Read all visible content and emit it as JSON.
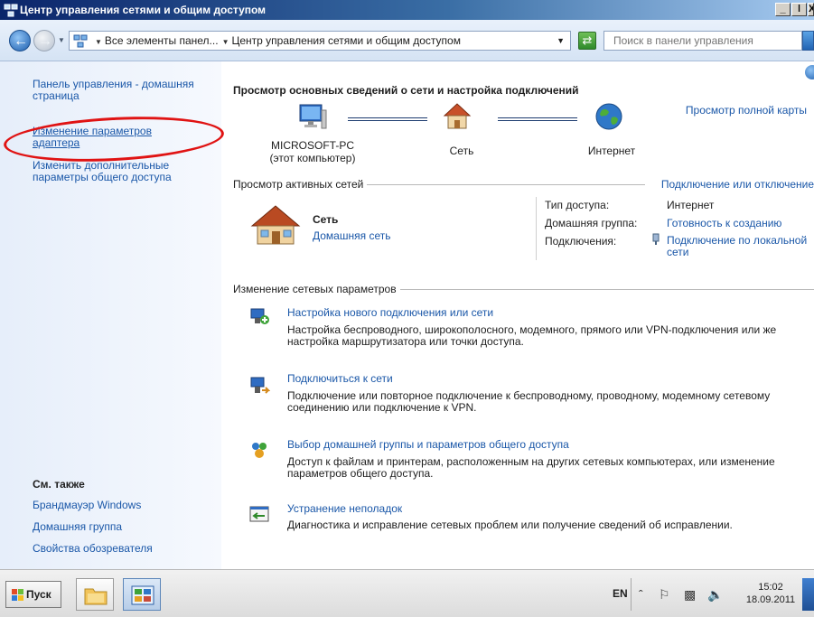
{
  "window": {
    "title": "Центр управления сетями и общим доступом",
    "min": "_",
    "max": "ǀ",
    "close": "X"
  },
  "address": {
    "crumbs": [
      "Все элементы панел...",
      "Центр управления сетями и общим доступом"
    ],
    "search_placeholder": "Поиск в панели управления"
  },
  "sidebar": {
    "home": "Панель управления - домашняя страница",
    "adapter": "Изменение параметров адаптера",
    "sharing": "Изменить дополнительные параметры общего доступа",
    "see_also": "См. также",
    "firewall": "Брандмауэр Windows",
    "homegroup": "Домашняя группа",
    "browser": "Свойства обозревателя"
  },
  "main": {
    "title": "Просмотр основных сведений о сети и настройка подключений",
    "full_map": "Просмотр полной карты",
    "nodes": {
      "pc_name": "MICROSOFT-PC",
      "pc_note": "(этот компьютер)",
      "network": "Сеть",
      "internet": "Интернет"
    },
    "active": {
      "title": "Просмотр активных сетей",
      "connect_link": "Подключение или отключение",
      "network_name": "Сеть",
      "network_type": "Домашняя сеть",
      "props": [
        {
          "label": "Тип доступа:",
          "value": "Интернет"
        },
        {
          "label": "Домашняя группа:",
          "value": "Готовность к созданию"
        },
        {
          "label": "Подключения:",
          "value": "Подключение по локальной сети"
        }
      ]
    },
    "change": {
      "title": "Изменение сетевых параметров",
      "tasks": [
        {
          "link": "Настройка нового подключения или сети",
          "desc": "Настройка беспроводного, широкополосного, модемного, прямого или VPN-подключения или же настройка маршрутизатора или точки доступа."
        },
        {
          "link": "Подключиться к сети",
          "desc": "Подключение или повторное подключение к беспроводному, проводному, модемному сетевому соединению или подключение к VPN."
        },
        {
          "link": "Выбор домашней группы и параметров общего доступа",
          "desc": "Доступ к файлам и принтерам, расположенным на других сетевых компьютерах, или изменение параметров общего доступа."
        },
        {
          "link": "Устранение неполадок",
          "desc": "Диагностика и исправление сетевых проблем или получение сведений об исправлении."
        }
      ]
    }
  },
  "taskbar": {
    "start": "Пуск",
    "lang": "EN",
    "time": "15:02",
    "date": "18.09.2011"
  },
  "colors": {
    "link": "#1a57a8",
    "highlight_ellipse": "#e01313",
    "title_bar": "#0a246a"
  }
}
